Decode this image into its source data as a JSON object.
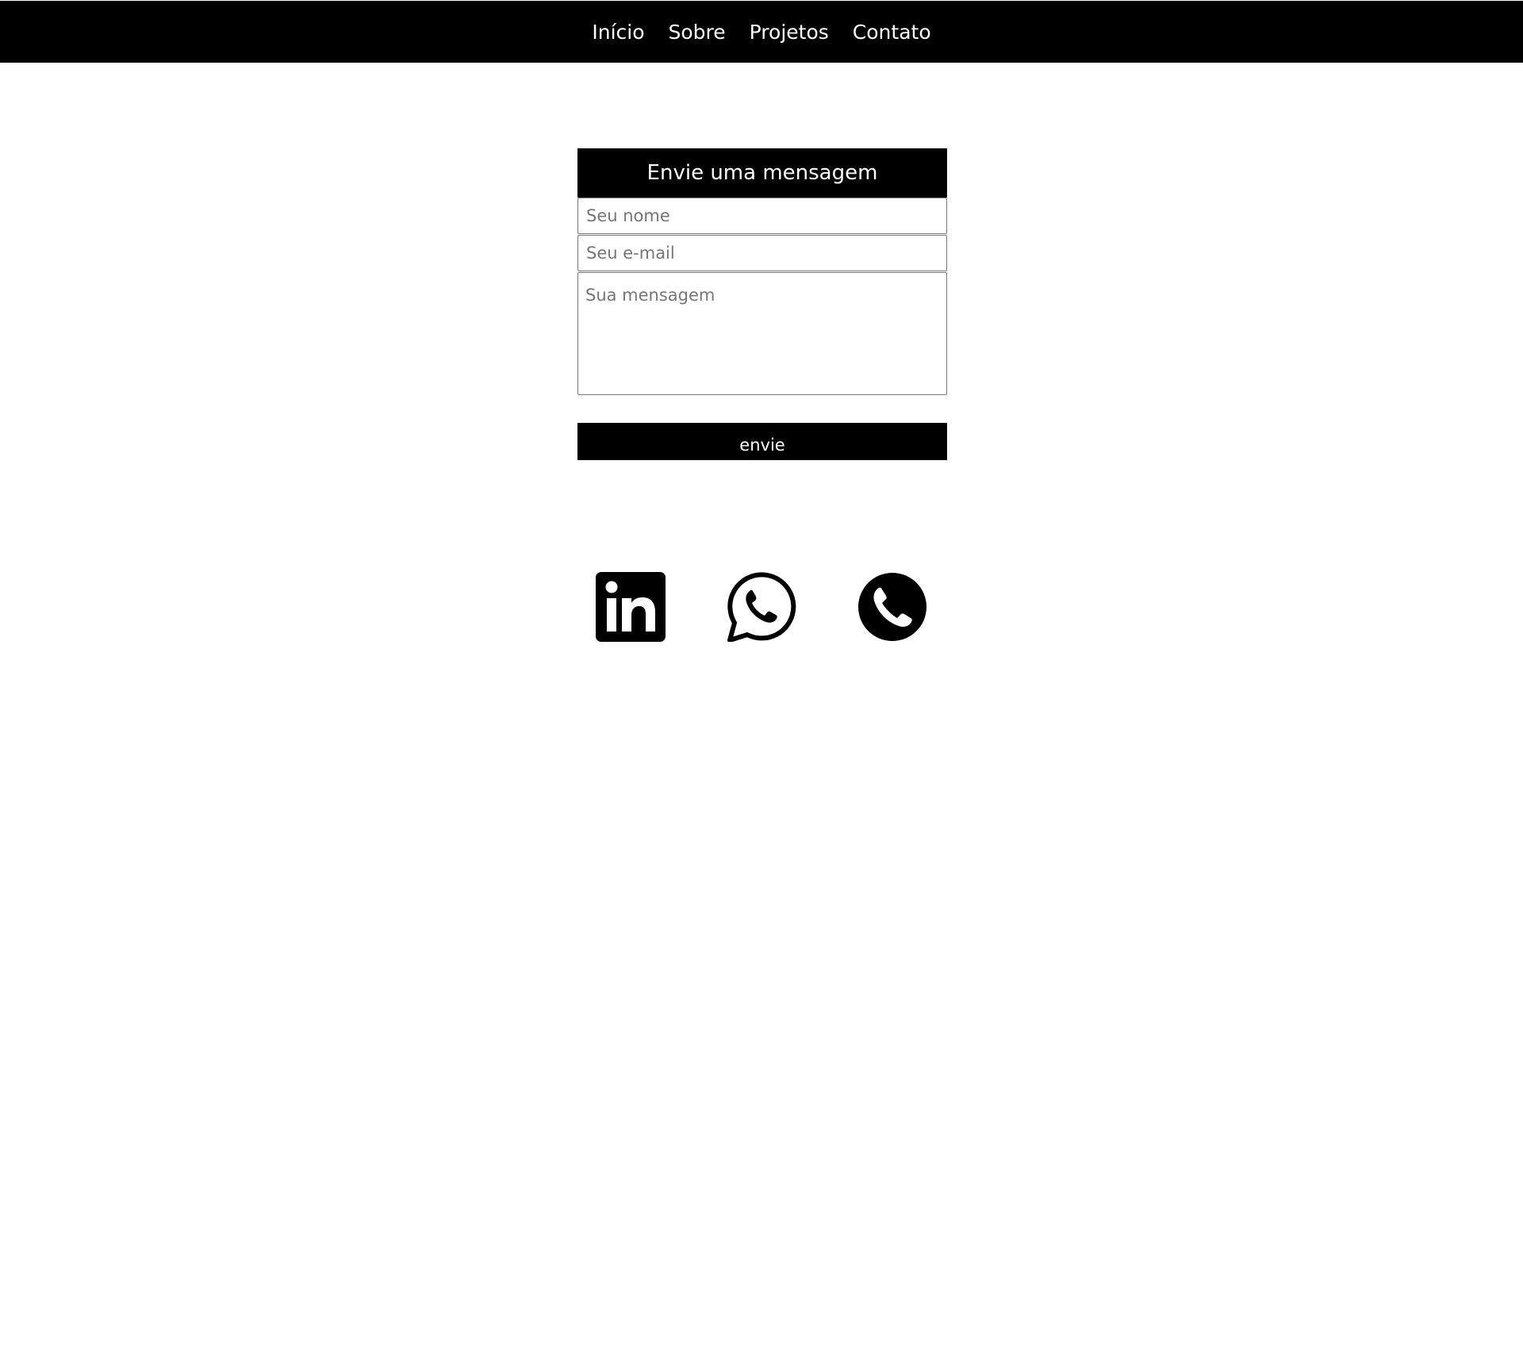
{
  "nav": {
    "links": [
      {
        "label": "Início"
      },
      {
        "label": "Sobre"
      },
      {
        "label": "Projetos"
      },
      {
        "label": "Contato"
      }
    ]
  },
  "form": {
    "title": "Envie uma mensagem",
    "name_placeholder": "Seu nome",
    "email_placeholder": "Seu e-mail",
    "message_placeholder": "Sua mensagem",
    "submit_label": "envie"
  },
  "social": {
    "icons": [
      "linkedin-icon",
      "whatsapp-icon",
      "phone-icon"
    ]
  },
  "colors": {
    "navbar": "#000000",
    "nav_text": "#ffffff",
    "form_header": "#000000",
    "button": "#000000",
    "icons": "#000000"
  }
}
